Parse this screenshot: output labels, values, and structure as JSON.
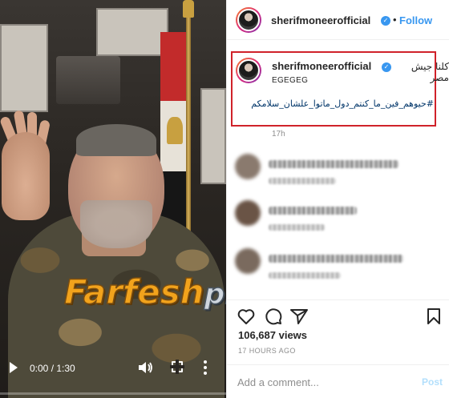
{
  "post": {
    "username": "sherifmoneerofficial",
    "follow_label": "Follow",
    "separator": "•",
    "caption_arabic": "كلنا جيش مصر",
    "caption_subtitle": "EGEGEG",
    "caption_hashtag": "#حيوهم_فين_ما_كنتم_دول_ماتوا_علشان_سلامكم",
    "caption_time": "17h",
    "views": "106,687 views",
    "posted_ago": "17 HOURS AGO",
    "comment_placeholder": "Add a comment...",
    "post_label": "Post"
  },
  "video": {
    "time_display": "0:00 / 1:30",
    "progress": 0
  },
  "watermark": {
    "part1": "Farfesh",
    "part2": "plus.com"
  },
  "icons": {
    "play": "play-icon",
    "volume": "volume-icon",
    "fullscreen": "fullscreen-icon",
    "video_more": "more-vertical-icon",
    "header_more": "more-horizontal-icon",
    "like": "heart-icon",
    "comment": "comment-icon",
    "share": "paper-plane-icon",
    "save": "bookmark-icon"
  },
  "colors": {
    "link": "#3897f0",
    "highlight": "#d0222a",
    "hashtag": "#003569"
  }
}
